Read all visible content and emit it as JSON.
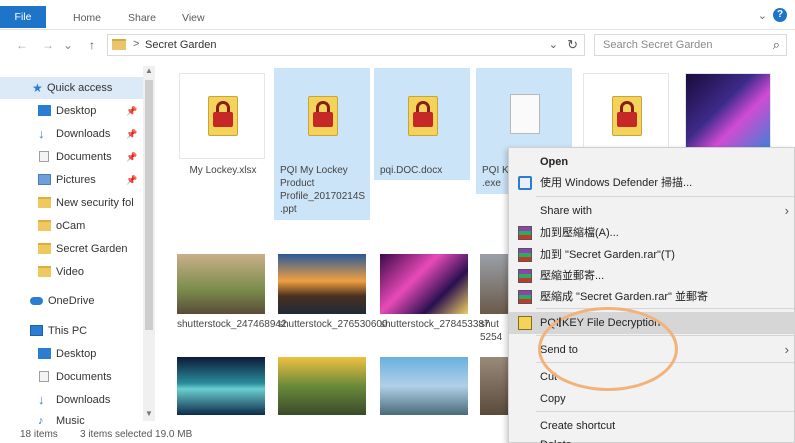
{
  "ribbon": {
    "tabs": [
      "File",
      "Home",
      "Share",
      "View"
    ],
    "help_label": "?",
    "expand_icon": "chevron-down-icon"
  },
  "address": {
    "back_icon": "←",
    "forward_icon": "→",
    "up_icon": "↑",
    "separator": ">",
    "breadcrumb": "Secret Garden",
    "dropdown_icon": "⌄",
    "refresh_icon": "↻",
    "search_placeholder": "Search Secret Garden",
    "search_icon": "⌕"
  },
  "sidebar": {
    "items": [
      {
        "label": "Quick access",
        "icon": "star-icon",
        "pinned": false
      },
      {
        "label": "Desktop",
        "icon": "desktop-icon",
        "pinned": true
      },
      {
        "label": "Downloads",
        "icon": "download-icon",
        "pinned": true
      },
      {
        "label": "Documents",
        "icon": "documents-icon",
        "pinned": true
      },
      {
        "label": "Pictures",
        "icon": "pictures-icon",
        "pinned": true
      },
      {
        "label": "New security fol",
        "icon": "folder-icon",
        "pinned": false
      },
      {
        "label": "oCam",
        "icon": "folder-icon",
        "pinned": false
      },
      {
        "label": "Secret Garden",
        "icon": "folder-icon",
        "pinned": false
      },
      {
        "label": "Video",
        "icon": "folder-icon",
        "pinned": false
      },
      {
        "label": "OneDrive",
        "icon": "cloud-icon",
        "pinned": false
      },
      {
        "label": "This PC",
        "icon": "computer-icon",
        "pinned": false
      },
      {
        "label": "Desktop",
        "icon": "desktop-icon",
        "pinned": false
      },
      {
        "label": "Documents",
        "icon": "documents-icon",
        "pinned": false
      },
      {
        "label": "Downloads",
        "icon": "download-icon",
        "pinned": false
      },
      {
        "label": "Music",
        "icon": "music-icon",
        "pinned": false
      }
    ],
    "pin_icon": "📌"
  },
  "files": [
    {
      "name": "My Lockey.xlsx",
      "selected": false,
      "type": "locked"
    },
    {
      "name": "PQI My Lockey Product Profile_20170214S.ppt",
      "selected": true,
      "type": "locked"
    },
    {
      "name": "pqi.DOC.docx",
      "selected": true,
      "type": "locked"
    },
    {
      "name": "PQI K .exe",
      "selected": true,
      "type": "plain"
    },
    {
      "name": "",
      "selected": false,
      "type": "locked"
    },
    {
      "name": "",
      "selected": false,
      "type": "image"
    }
  ],
  "photos": [
    {
      "name": "shutterstock_247468942"
    },
    {
      "name": "shutterstock_276530600"
    },
    {
      "name": "shutterstock_278453387"
    },
    {
      "name": "shut 5254"
    }
  ],
  "status": {
    "items_count": "18 items",
    "selected": "3 items selected  19.0 MB"
  },
  "context_menu": {
    "items": [
      {
        "label": "Open",
        "bold": true
      },
      {
        "label": "使用 Windows Defender 掃描...",
        "icon": "defender-icon"
      },
      {
        "label": "Share with",
        "submenu": true
      },
      {
        "label": "加到壓縮檔(A)...",
        "icon": "winrar-icon"
      },
      {
        "label": "加到 \"Secret Garden.rar\"(T)",
        "icon": "winrar-icon"
      },
      {
        "label": "壓縮並郵寄...",
        "icon": "winrar-icon"
      },
      {
        "label": "壓縮成 \"Secret Garden.rar\" 並郵寄",
        "icon": "winrar-icon"
      },
      {
        "label": "PQI KEY File Decryption",
        "icon": "pqi-icon",
        "highlighted": true
      },
      {
        "label": "Send to",
        "submenu": true
      },
      {
        "label": "Cut"
      },
      {
        "label": "Copy"
      },
      {
        "label": "Create shortcut"
      },
      {
        "label": "Delete"
      }
    ],
    "submenu_arrow": "›"
  },
  "colors": {
    "accent": "#1e74c8",
    "selection": "#cce4f7",
    "circle": "#f2b27a"
  }
}
